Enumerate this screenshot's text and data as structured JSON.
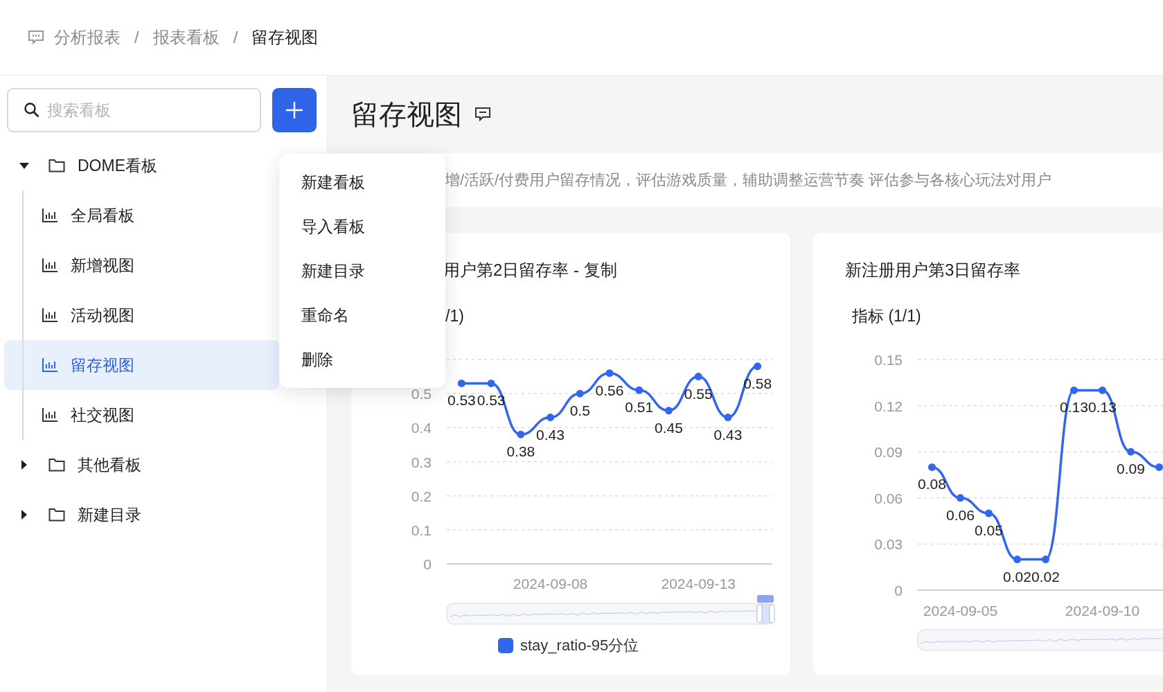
{
  "breadcrumb": [
    {
      "kind": "link",
      "label": "分析报表"
    },
    {
      "kind": "separator",
      "label": "/"
    },
    {
      "kind": "link",
      "label": "报表看板"
    },
    {
      "kind": "separator",
      "label": "/"
    },
    {
      "kind": "current",
      "label": "留存视图"
    }
  ],
  "sidebar": {
    "search": {
      "placeholder": "搜索看板"
    },
    "tree": [
      {
        "kind": "folder",
        "label": "DOME看板",
        "expanded": true,
        "selected": false,
        "children": [
          {
            "kind": "chart",
            "label": "全局看板",
            "selected": false
          },
          {
            "kind": "chart",
            "label": "新增视图",
            "selected": false
          },
          {
            "kind": "chart",
            "label": "活动视图",
            "selected": false
          },
          {
            "kind": "chart",
            "label": "留存视图",
            "selected": true
          },
          {
            "kind": "chart",
            "label": "社交视图",
            "selected": false
          }
        ]
      },
      {
        "kind": "folder",
        "label": "其他看板",
        "expanded": false,
        "selected": false
      },
      {
        "kind": "folder",
        "label": "新建目录",
        "expanded": false,
        "selected": false
      }
    ]
  },
  "context_menu": {
    "items": [
      "新建看板",
      "导入看板",
      "新建目录",
      "重命名",
      "删除"
    ]
  },
  "main": {
    "title": "留存视图",
    "description": "增/活跃/付费用户留存情况，评估游戏质量，辅助调整运营节奏 评估参与各核心玩法对用户",
    "cards": [
      {
        "title": "用户第2日留存率 - 复制",
        "subtitle": "/1)",
        "chart_data": {
          "type": "line",
          "categories": [
            null,
            null,
            null,
            "2024-09-08",
            null,
            null,
            null,
            null,
            "2024-09-13",
            null,
            null
          ],
          "ylim": [
            0,
            0.6
          ],
          "yticks": [
            0,
            0.1,
            0.2,
            0.3,
            0.4,
            0.5
          ],
          "grid": true,
          "data_labels": true,
          "series": [
            {
              "name": "stay_ratio-95分位",
              "color": "#3366ee",
              "marker": true,
              "values": [
                0.53,
                0.53,
                0.38,
                0.43,
                0.5,
                0.56,
                0.51,
                0.45,
                0.55,
                0.43,
                0.58
              ]
            }
          ]
        }
      },
      {
        "title": "新注册用户第3日留存率",
        "subtitle": "指标 (1/1)",
        "chart_data": {
          "type": "line",
          "categories": [
            null,
            "2024-09-05",
            null,
            null,
            null,
            null,
            "2024-09-10",
            null,
            null
          ],
          "ylim": [
            0,
            0.15
          ],
          "yticks": [
            0,
            0.03,
            0.06,
            0.09,
            0.12,
            0.15
          ],
          "grid": true,
          "value_labels": [
            "0.08",
            "0.06",
            "0.05",
            "0.02",
            "0.02",
            "0.13",
            "0.13",
            "0.09",
            null
          ],
          "series": [
            {
              "color": "#3366ee",
              "marker": true,
              "values": [
                0.08,
                0.06,
                0.05,
                0.02,
                0.02,
                0.13,
                0.13,
                0.09,
                0.08
              ]
            }
          ]
        }
      }
    ]
  }
}
